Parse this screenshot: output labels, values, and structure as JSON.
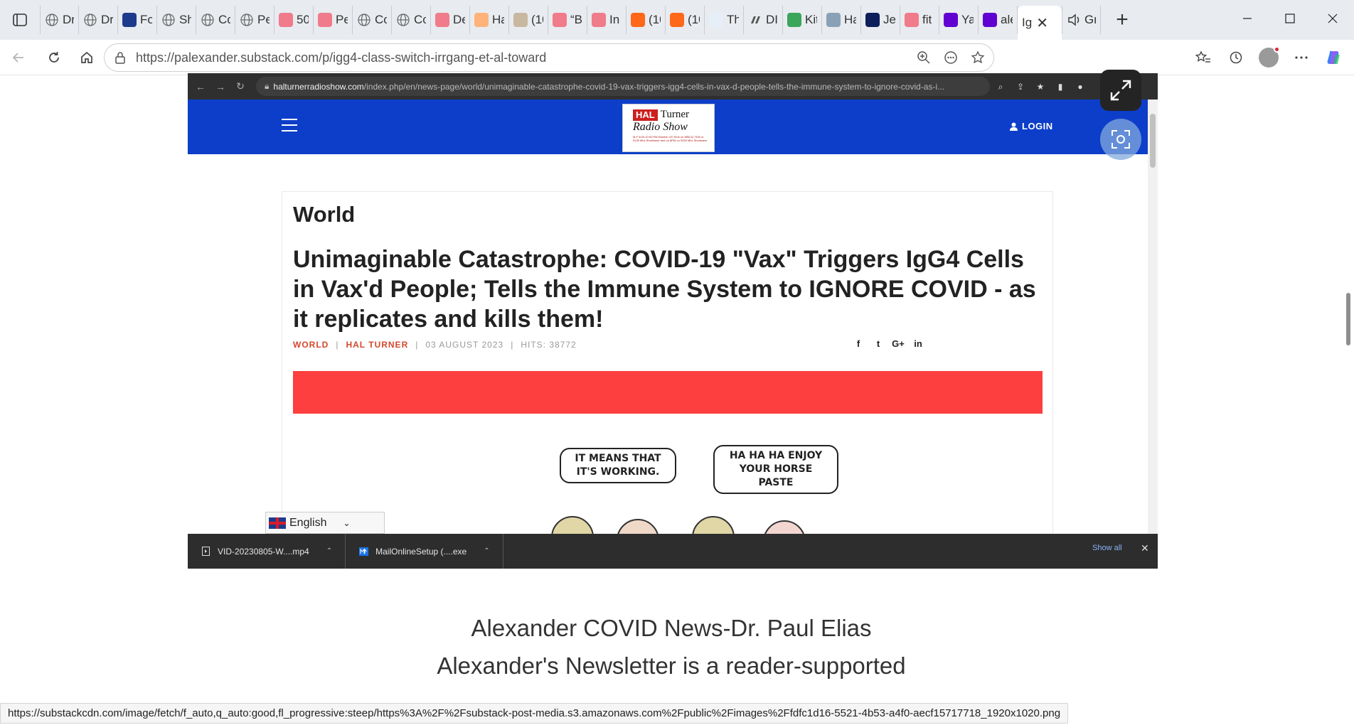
{
  "browser": {
    "tabs": [
      {
        "label": "Dr",
        "favicon": "globe-icon"
      },
      {
        "label": "Dr",
        "favicon": "globe-icon"
      },
      {
        "label": "Fo",
        "favicon": "fox-news-icon"
      },
      {
        "label": "Sh",
        "favicon": "globe-icon"
      },
      {
        "label": "Co",
        "favicon": "globe-icon"
      },
      {
        "label": "Pe",
        "favicon": "globe-icon"
      },
      {
        "label": "50",
        "favicon": "youtube-icon"
      },
      {
        "label": "Pe",
        "favicon": "youtube-icon"
      },
      {
        "label": "Co",
        "favicon": "gear-icon"
      },
      {
        "label": "Co",
        "favicon": "globe-icon"
      },
      {
        "label": "De",
        "favicon": "youtube-icon"
      },
      {
        "label": "Ha",
        "favicon": "orange-b-icon"
      },
      {
        "label": "(10",
        "favicon": "image-icon"
      },
      {
        "label": "“Bi",
        "favicon": "youtube-icon"
      },
      {
        "label": "In",
        "favicon": "youtube-icon"
      },
      {
        "label": "(10",
        "favicon": "substack-icon"
      },
      {
        "label": "(10",
        "favicon": "substack-icon"
      },
      {
        "label": "Th",
        "favicon": "gp-icon"
      },
      {
        "label": "DI",
        "favicon": "dr-icon"
      },
      {
        "label": "Kit",
        "favicon": "green-bars-icon"
      },
      {
        "label": "Ha",
        "favicon": "seal-icon"
      },
      {
        "label": "Je",
        "favicon": "jet-icon"
      },
      {
        "label": "fit",
        "favicon": "youtube-icon"
      },
      {
        "label": "Ya",
        "favicon": "yahoo-icon"
      },
      {
        "label": "ale",
        "favicon": "yahoo-icon"
      }
    ],
    "active_tab": {
      "label": "Ig"
    },
    "after_tabs": [
      {
        "label": "Gr",
        "favicon": "speaker-icon"
      }
    ],
    "new_tab_label": "+",
    "url_host": "https://palexander.substack.com",
    "url_path": "/p/igg4-class-switch-irrgang-et-al-toward"
  },
  "embedded": {
    "url_host": "halturnerradioshow.com",
    "url_path": "/index.php/en/news-page/world/unimaginable-catastrophe-covid-19-vax-triggers-igg4-cells-in-vax-d-people-tells-the-immune-system-to-ignore-covid-as-i...",
    "logo": {
      "hal": "HAL",
      "turner": "Turner",
      "radio": "Radio Show",
      "small": "M-F 8:00-10:00 PM Eastern US Time on WBCQ 7490 or 5130 Mhz Shortwave and on 6PM on 9330 Mhz Shortwave"
    },
    "login_label": "LOGIN",
    "section": "World",
    "headline": "Unimaginable Catastrophe: COVID-19 \"Vax\" Triggers IgG4 Cells in Vax'd People; Tells the Immune System to IGNORE COVID - as it replicates and kills them!",
    "meta": {
      "category": "WORLD",
      "author": "HAL TURNER",
      "date": "03 AUGUST 2023",
      "hits": "HITS: 38772",
      "sep": "|"
    },
    "social": [
      "f",
      "t",
      "G+",
      "in"
    ],
    "cartoon": {
      "bubble1": "IT MEANS THAT IT'S WORKING.",
      "bubble2": "HA HA HA ENJOY YOUR HORSE PASTE"
    },
    "language": "English",
    "downloads": [
      {
        "name": "VID-20230805-W....mp4"
      },
      {
        "name": "MailOnlineSetup (....exe"
      }
    ],
    "show_all": "Show all"
  },
  "page": {
    "title": "Alexander COVID News-Dr. Paul Elias",
    "subtitle": "Alexander's Newsletter is a reader-supported"
  },
  "status_bar": "https://substackcdn.com/image/fetch/f_auto,q_auto:good,fl_progressive:steep/https%3A%2F%2Fsubstack-post-media.s3.amazonaws.com%2Fpublic%2Fimages%2Ffdfc1d16-5521-4b53-a4f0-aecf15717718_1920x1020.png",
  "colors": {
    "header_blue": "#0d3ec9",
    "accent_red": "#fe3f3f",
    "meta_red": "#d2492c"
  }
}
